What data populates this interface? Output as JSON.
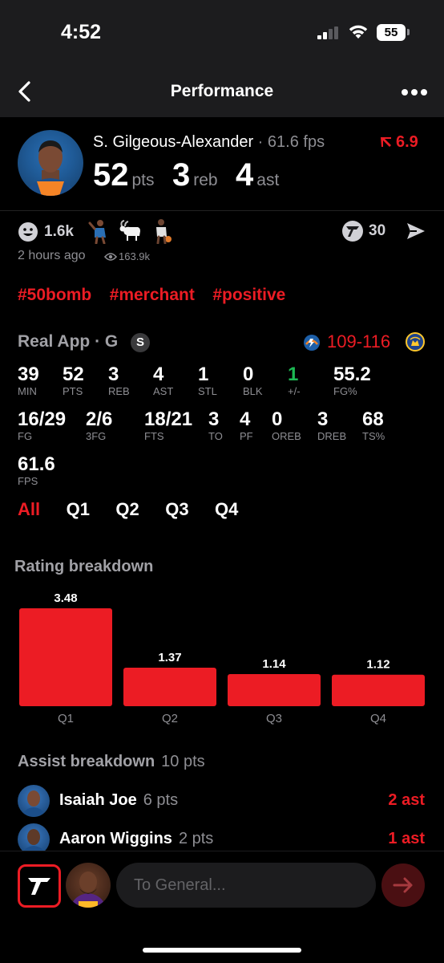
{
  "status_bar": {
    "time": "4:52",
    "battery": "55"
  },
  "nav": {
    "title": "Performance"
  },
  "player": {
    "name": "S. Gilgeous-Alexander",
    "separator": "·",
    "fps": "61.6 fps",
    "rating_delta": "6.9",
    "stats": [
      {
        "value": "52",
        "unit": "pts"
      },
      {
        "value": "3",
        "unit": "reb"
      },
      {
        "value": "4",
        "unit": "ast"
      }
    ]
  },
  "social": {
    "reactions": "1.6k",
    "posted": "2 hours ago",
    "views": "163.9k",
    "votes": "30"
  },
  "hashtags": [
    "#50bomb",
    "#merchant",
    "#positive"
  ],
  "game": {
    "league": "Real App · G",
    "badge": "S",
    "team_score": "109",
    "dash": "-",
    "opp_score": "116"
  },
  "box_score": [
    {
      "value": "39",
      "label": "MIN"
    },
    {
      "value": "52",
      "label": "PTS"
    },
    {
      "value": "3",
      "label": "REB"
    },
    {
      "value": "4",
      "label": "AST"
    },
    {
      "value": "1",
      "label": "STL"
    },
    {
      "value": "0",
      "label": "BLK"
    },
    {
      "value": "1",
      "label": "+/-"
    },
    {
      "value": "55.2",
      "label": "FG%"
    },
    {
      "value": "16/29",
      "label": "FG"
    },
    {
      "value": "2/6",
      "label": "3FG"
    },
    {
      "value": "18/21",
      "label": "FTS"
    },
    {
      "value": "3",
      "label": "TO"
    },
    {
      "value": "4",
      "label": "PF"
    },
    {
      "value": "0",
      "label": "OREB"
    },
    {
      "value": "3",
      "label": "DREB"
    },
    {
      "value": "68",
      "label": "TS%"
    },
    {
      "value": "61.6",
      "label": "FPS"
    }
  ],
  "quarter_tabs": [
    "All",
    "Q1",
    "Q2",
    "Q3",
    "Q4"
  ],
  "rating_section": {
    "title": "Rating breakdown"
  },
  "chart_data": {
    "type": "bar",
    "categories": [
      "Q1",
      "Q2",
      "Q3",
      "Q4"
    ],
    "values": [
      3.48,
      1.37,
      1.14,
      1.12
    ],
    "title": "Rating breakdown",
    "xlabel": "",
    "ylabel": "",
    "ylim": [
      0,
      3.48
    ],
    "grid": false,
    "bar_color": "#ec1c24"
  },
  "assist_section": {
    "title": "Assist breakdown",
    "points": "10 pts",
    "rows": [
      {
        "name": "Isaiah Joe",
        "points": "6 pts",
        "assists": "2 ast"
      },
      {
        "name": "Aaron Wiggins",
        "points": "2 pts",
        "assists": "1 ast"
      }
    ]
  },
  "composer": {
    "placeholder": "To General..."
  },
  "colors": {
    "accent": "#ec1c24",
    "positive": "#1db954",
    "muted": "#8e8e93",
    "background": "#000000"
  }
}
